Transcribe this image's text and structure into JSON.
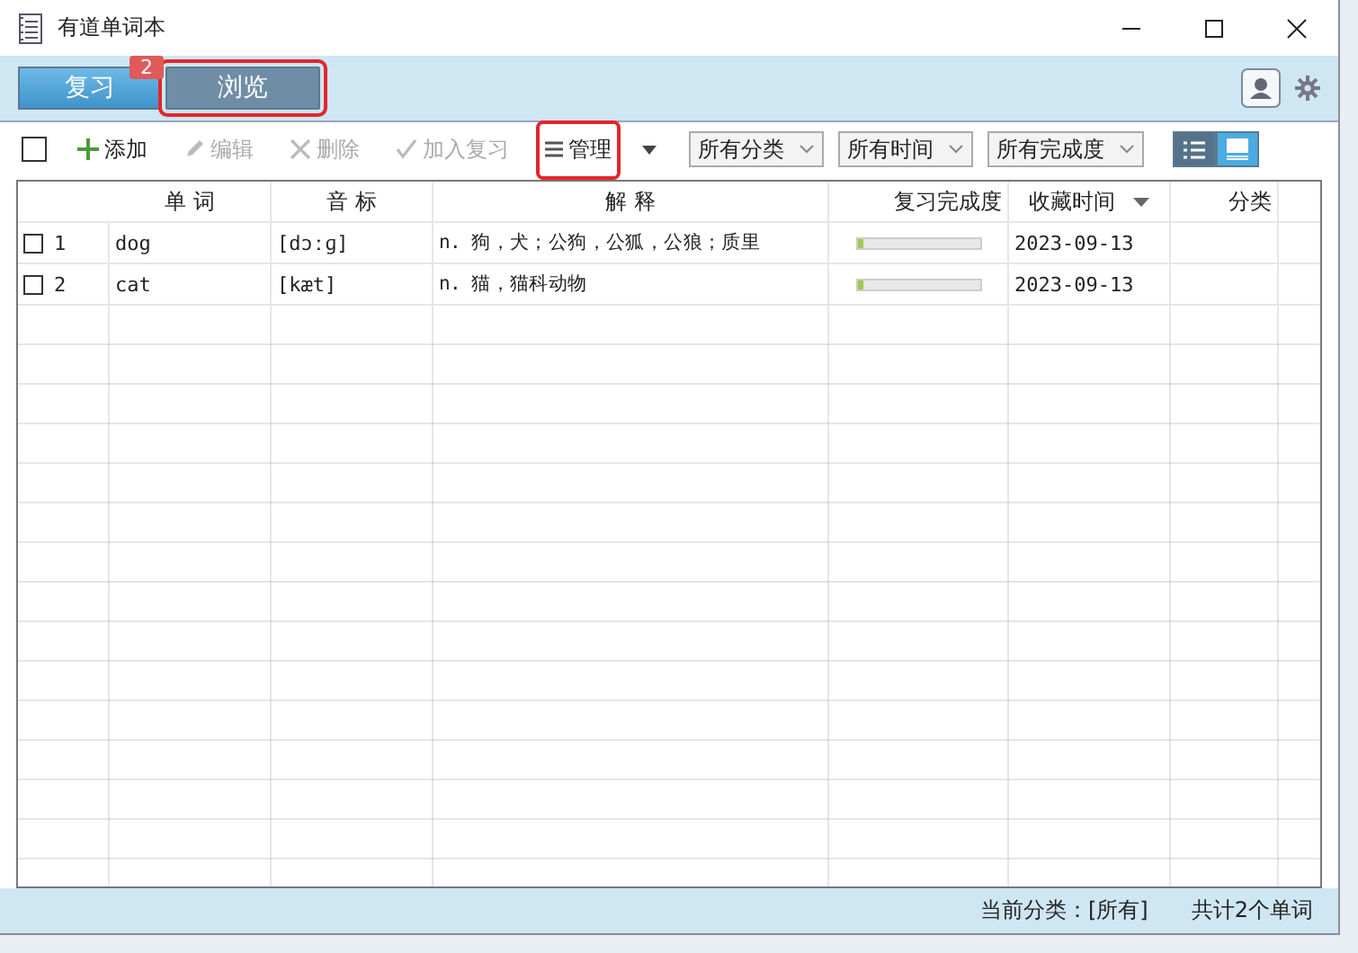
{
  "window": {
    "title": "有道单词本"
  },
  "tabs": [
    {
      "label": "复习",
      "selected": false,
      "highlighted": false
    },
    {
      "label": "浏览",
      "selected": true,
      "highlighted": true
    }
  ],
  "annotation_badge": "2",
  "toolbar": {
    "select_all": {
      "checked": false
    },
    "items": [
      {
        "label": "添加",
        "disabled": false,
        "highlighted": false
      },
      {
        "label": "编辑",
        "disabled": true,
        "highlighted": false
      },
      {
        "label": "删除",
        "disabled": true,
        "highlighted": false
      },
      {
        "label": "加入复习",
        "disabled": true,
        "highlighted": false
      },
      {
        "label": "管理",
        "disabled": false,
        "highlighted": true
      }
    ],
    "filters": [
      "所有分类",
      "所有时间",
      "所有完成度"
    ],
    "views": [
      {
        "kind": "list",
        "selected": true
      },
      {
        "kind": "card",
        "selected": false
      }
    ]
  },
  "table": {
    "columns": [
      "单 词",
      "音 标",
      "解 释",
      "复习完成度",
      "收藏时间",
      "分类"
    ],
    "rows": [
      {
        "checked": false,
        "index": "1",
        "word": "dog",
        "phonetic": "[dɔːɡ]",
        "meaning": "n. 狗，犬；公狗，公狐，公狼；质里",
        "level": 0.04,
        "date": "2023-09-13"
      },
      {
        "checked": false,
        "index": "2",
        "word": "cat",
        "phonetic": "[kæt]",
        "meaning": "n. 猫，猫科动物",
        "level": 0.04,
        "date": "2023-09-13"
      }
    ]
  },
  "status_bar": {
    "category": "当前分类：[所有]",
    "count": "共计2个单词"
  }
}
